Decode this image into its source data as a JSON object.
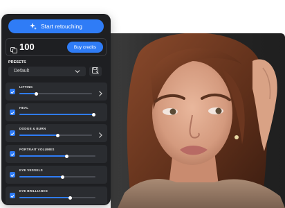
{
  "panel": {
    "start_button": {
      "label": "Start retouching",
      "icon": "sparkle-icon"
    },
    "credits": {
      "icon": "coins-icon",
      "count": "100",
      "buy_label": "Buy credits"
    },
    "presets": {
      "label": "PRESETS",
      "selected": "Default",
      "save_icon": "save-preset-icon"
    },
    "tools": [
      {
        "label": "LIFTING",
        "checked": true,
        "level": 0.23,
        "has_arrow": true
      },
      {
        "label": "HEAL",
        "checked": true,
        "level": 0.98,
        "has_arrow": false
      },
      {
        "label": "DODGE & BURN",
        "checked": true,
        "level": 0.53,
        "has_arrow": true
      },
      {
        "label": "PORTRAIT VOLUMES",
        "checked": true,
        "level": 0.62,
        "has_arrow": false
      },
      {
        "label": "EYE VESSELS",
        "checked": true,
        "level": 0.57,
        "has_arrow": false
      },
      {
        "label": "EYE BRILLIANCE",
        "checked": true,
        "level": 0.67,
        "has_arrow": false
      }
    ]
  },
  "colors": {
    "accent": "#2f7cf6",
    "panel_bg": "#1e1f22",
    "row_bg": "#2a2c30"
  },
  "photo": {
    "subject": "portrait-photo"
  }
}
